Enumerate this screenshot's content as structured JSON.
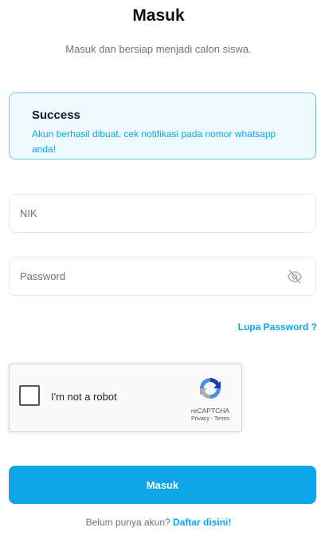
{
  "header": {
    "title": "Masuk",
    "subtitle": "Masuk dan bersiap menjadi calon siswa."
  },
  "alert": {
    "title": "Success",
    "message": "Akun berhasil dibuat. cek notifikasi pada nomor whatsapp anda!"
  },
  "form": {
    "nik_placeholder": "NIK",
    "password_placeholder": "Password",
    "password_toggle_icon": "eye-slash-icon",
    "forgot_password_label": "Lupa Password ?",
    "submit_label": "Masuk"
  },
  "recaptcha": {
    "label": "I'm not a robot",
    "brand": "reCAPTCHA",
    "links": "Privacy - Terms",
    "checked": false
  },
  "footer": {
    "prompt": "Belum punya akun?",
    "register_link": "Daftar disini!"
  },
  "colors": {
    "primary": "#0ea5e9",
    "alert_background": "#effaff",
    "alert_border": "#6cc6ef"
  }
}
